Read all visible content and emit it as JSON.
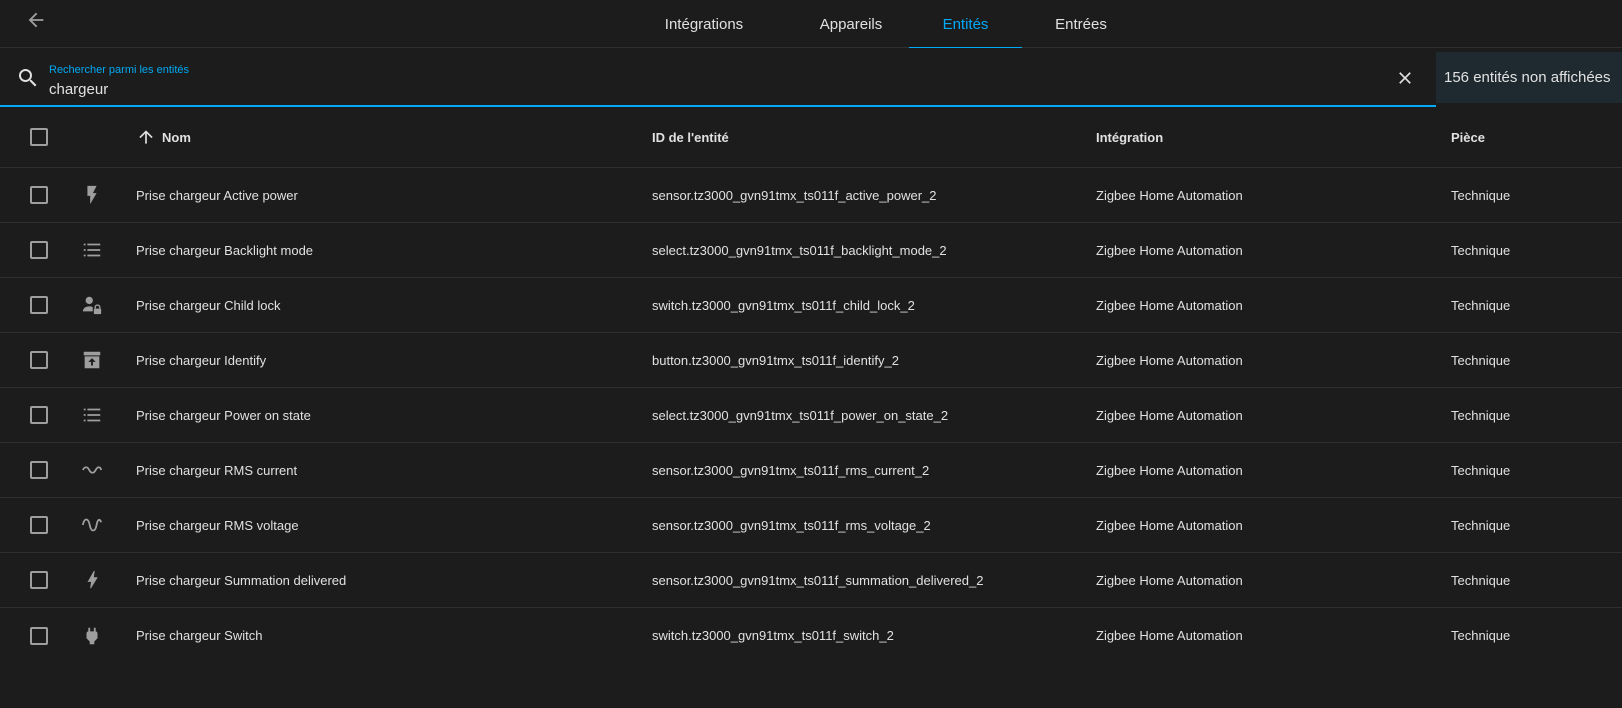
{
  "tabs": [
    {
      "label": "Intégrations",
      "active": false
    },
    {
      "label": "Appareils",
      "active": false
    },
    {
      "label": "Entités",
      "active": true
    },
    {
      "label": "Entrées",
      "active": false
    }
  ],
  "search": {
    "label": "Rechercher parmi les entités",
    "value": "chargeur"
  },
  "hidden_badge": "156 entités non affichées",
  "columns": {
    "name": "Nom",
    "entity_id": "ID de l'entité",
    "integration": "Intégration",
    "area": "Pièce"
  },
  "rows": [
    {
      "icon": "flash-icon",
      "name": "Prise chargeur Active power",
      "entity_id": "sensor.tz3000_gvn91tmx_ts011f_active_power_2",
      "integration": "Zigbee Home Automation",
      "area": "Technique"
    },
    {
      "icon": "format-list-icon",
      "name": "Prise chargeur Backlight mode",
      "entity_id": "select.tz3000_gvn91tmx_ts011f_backlight_mode_2",
      "integration": "Zigbee Home Automation",
      "area": "Technique"
    },
    {
      "icon": "account-lock-icon",
      "name": "Prise chargeur Child lock",
      "entity_id": "switch.tz3000_gvn91tmx_ts011f_child_lock_2",
      "integration": "Zigbee Home Automation",
      "area": "Technique"
    },
    {
      "icon": "archive-arrow-up-icon",
      "name": "Prise chargeur Identify",
      "entity_id": "button.tz3000_gvn91tmx_ts011f_identify_2",
      "integration": "Zigbee Home Automation",
      "area": "Technique"
    },
    {
      "icon": "format-list-icon",
      "name": "Prise chargeur Power on state",
      "entity_id": "select.tz3000_gvn91tmx_ts011f_power_on_state_2",
      "integration": "Zigbee Home Automation",
      "area": "Technique"
    },
    {
      "icon": "current-ac-icon",
      "name": "Prise chargeur RMS current",
      "entity_id": "sensor.tz3000_gvn91tmx_ts011f_rms_current_2",
      "integration": "Zigbee Home Automation",
      "area": "Technique"
    },
    {
      "icon": "sine-wave-icon",
      "name": "Prise chargeur RMS voltage",
      "entity_id": "sensor.tz3000_gvn91tmx_ts011f_rms_voltage_2",
      "integration": "Zigbee Home Automation",
      "area": "Technique"
    },
    {
      "icon": "lightning-bolt-icon",
      "name": "Prise chargeur Summation delivered",
      "entity_id": "sensor.tz3000_gvn91tmx_ts011f_summation_delivered_2",
      "integration": "Zigbee Home Automation",
      "area": "Technique"
    },
    {
      "icon": "power-plug-icon",
      "name": "Prise chargeur Switch",
      "entity_id": "switch.tz3000_gvn91tmx_ts011f_switch_2",
      "integration": "Zigbee Home Automation",
      "area": "Technique"
    }
  ],
  "colors": {
    "accent": "#03a9f4",
    "background": "#1c1c1c",
    "text": "#e1e1e1",
    "icon": "#9e9e9e"
  }
}
